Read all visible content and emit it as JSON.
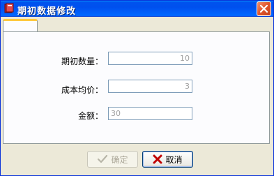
{
  "window": {
    "title": "期初数据修改"
  },
  "form": {
    "quantity": {
      "label": "期初数量：",
      "value": "10"
    },
    "avg_cost": {
      "label": "成本均价：",
      "value": "3"
    },
    "amount": {
      "label": "金额：",
      "value": "30"
    }
  },
  "buttons": {
    "ok_label": "确定",
    "cancel_label": "取消"
  }
}
